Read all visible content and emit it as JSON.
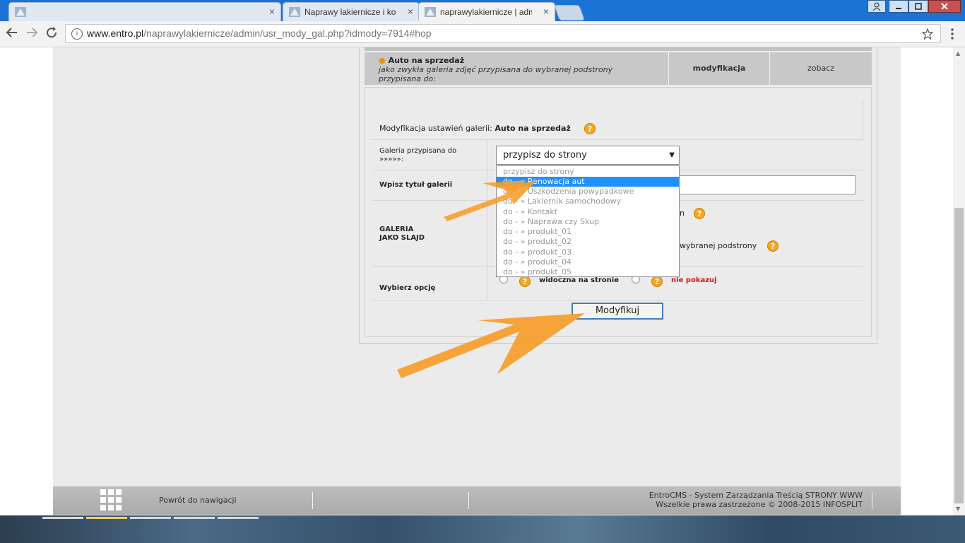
{
  "browser": {
    "tabs": [
      {
        "title": "",
        "active": false
      },
      {
        "title": "Naprawy lakiernicze i kor",
        "active": false
      },
      {
        "title": "naprawylakiernicze | adm",
        "active": true
      }
    ],
    "tab_close_glyph": "×",
    "url_host": "www.entro.pl",
    "url_path": "/naprawylakiernicze/admin/usr_mody_gal.php?idmody=7914#hop",
    "icons": [
      "back-icon",
      "forward-icon",
      "reload-icon",
      "info-icon",
      "star-icon",
      "menu-icon",
      "user-icon",
      "minimize-icon",
      "maximize-icon",
      "close-icon"
    ]
  },
  "gallery": {
    "name": "Auto na sprzedaż",
    "description_line1": "jako zwykła galeria zdjęć przypisana do wybranej podstrony",
    "description_line2": "przypisana do:",
    "modify_label": "modyfikacja",
    "view_label": "zobacz"
  },
  "form": {
    "heading_prefix": "Modyfikacja ustawień galerii:",
    "heading_name": "Auto na sprzedaż",
    "assigned_label_line1": "Galeria przypisana do",
    "assigned_label_line2": "»»»»»:",
    "select_value": "przypisz do strony",
    "title_label": "Wpisz tytuł galerii",
    "slide_label_line1": "GALERIA",
    "slide_label_line2": "JAKO SLAJD",
    "slide_option1_tail": "n",
    "slide_option2_tail": "wybranej podstrony",
    "choose_label": "Wybierz opcję",
    "visible_label": "widoczna na stronie",
    "hidden_label": "nie pokazuj",
    "submit_label": "Modyfikuj",
    "help_glyph": "?"
  },
  "dropdown": {
    "options": [
      "przypisz do strony",
      "do - » Renowacja aut",
      "do - » Uszkodzenia powypadkowe",
      "do - » Lakiernik samochodowy",
      "do - » Kontakt",
      "do - » Naprawa czy Skup",
      "do - » produkt_01",
      "do - » produkt_02",
      "do - » produkt_03",
      "do - » produkt_04",
      "do - » produkt_05"
    ],
    "selected_index": 1
  },
  "footer": {
    "back_label": "Powrót do nawigacji",
    "line1": "EntroCMS - System Zarządzania Treścią STRONY WWW",
    "line2": "Wszelkie prawa zastrzeżone © 2008-2015 INFOSPLIT"
  },
  "colors": {
    "annotation_arrow": "#f7a030",
    "selected_option": "#1e90ff",
    "hidden_label": "#e01010",
    "bullet": "#f39200"
  }
}
